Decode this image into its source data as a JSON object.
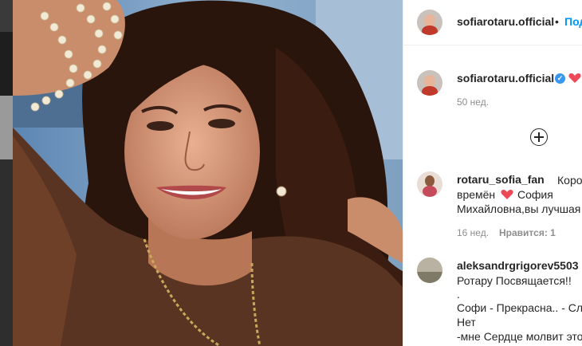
{
  "header": {
    "username": "sofiarotaru.official",
    "separator": "•",
    "follow_label": "Подписаться"
  },
  "caption": {
    "username": "sofiarotaru.official",
    "time": "50 нед."
  },
  "load_more": {
    "icon": "plus-circle-icon"
  },
  "comments": [
    {
      "username": "rotaru_sofia_fan",
      "line1": "Королева всех",
      "line2a": "времён",
      "line2b": "София",
      "line3": "Михайловна,вы лучшая",
      "time": "16 нед.",
      "likes": "Нравится: 1"
    },
    {
      "username": "aleksandrgrigorev5503",
      "lines": [
        "Ротару Посвящается!!",
        ".",
        "Софи - Прекрасна.. - Слова",
        "Нет",
        "-мне Сердце молвит это"
      ]
    }
  ],
  "colors": {
    "accent": "#0095f6",
    "heart": "#ed4956",
    "verified": "#3897f0",
    "text": "#262626",
    "muted": "#8e8e8e"
  }
}
